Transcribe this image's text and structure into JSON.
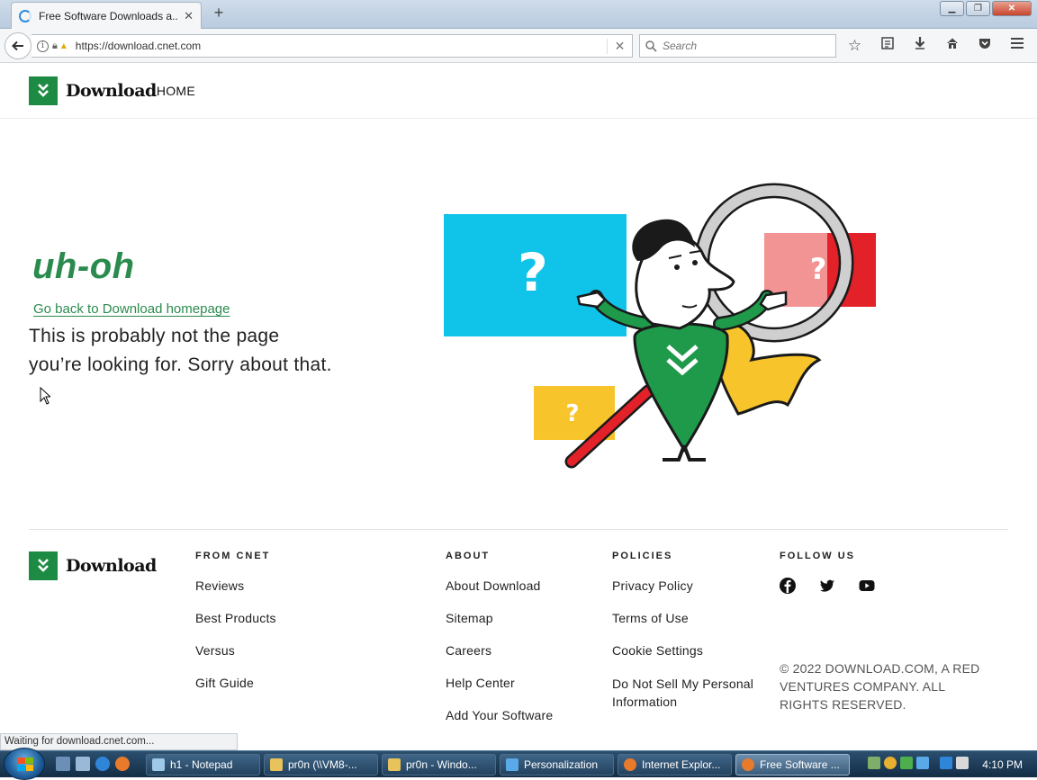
{
  "browser": {
    "tab_title": "Free Software Downloads a...",
    "url": "https://download.cnet.com",
    "search_placeholder": "Search",
    "status_text": "Waiting for download.cnet.com..."
  },
  "header": {
    "logo_text": "Download",
    "home_label": "HOME"
  },
  "main": {
    "heading": "uh-oh",
    "back_link": "Go back to Download homepage",
    "message": "This is probably not the page you’re looking for. Sorry about that."
  },
  "footer": {
    "logo_text": "Download",
    "columns": [
      {
        "title": "FROM CNET",
        "links": [
          "Reviews",
          "Best Products",
          "Versus",
          "Gift Guide"
        ]
      },
      {
        "title": "ABOUT",
        "links": [
          "About Download",
          "Sitemap",
          "Careers",
          "Help Center",
          "Add Your Software"
        ]
      },
      {
        "title": "POLICIES",
        "links": [
          "Privacy Policy",
          "Terms of Use",
          "Cookie Settings",
          "Do Not Sell My Personal Information"
        ]
      }
    ],
    "follow_title": "FOLLOW US",
    "social": [
      "facebook-icon",
      "twitter-icon",
      "youtube-icon"
    ],
    "copyright": "© 2022 DOWNLOAD.COM, A RED VENTURES COMPANY. ALL RIGHTS RESERVED."
  },
  "taskbar": {
    "tasks": [
      {
        "label": "h1 - Notepad",
        "color": "#9ec7e8"
      },
      {
        "label": "pr0n (\\\\VM8-...",
        "color": "#e8c25a"
      },
      {
        "label": "pr0n - Windo...",
        "color": "#e8c25a"
      },
      {
        "label": "Personalization",
        "color": "#5aa9e8"
      },
      {
        "label": "Internet Explor...",
        "color": "#e87a2c"
      },
      {
        "label": "Free Software ...",
        "color": "#e87a2c"
      }
    ],
    "clock": "4:10 PM"
  },
  "colors": {
    "brand_green": "#1d8b43",
    "heading_green": "#2b8b4e"
  }
}
